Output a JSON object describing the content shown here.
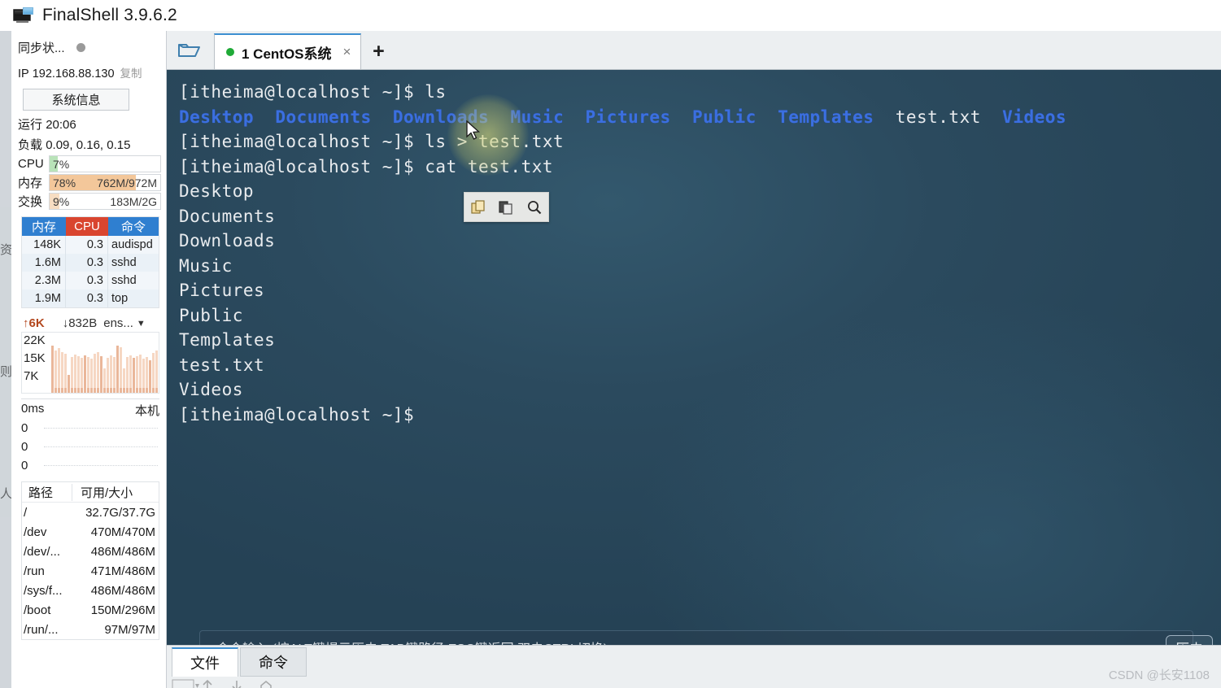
{
  "app": {
    "title": "FinalShell 3.9.6.2",
    "icon": "computer-monitor-icon"
  },
  "sidebar": {
    "ghost_text": "资 则 人",
    "sync": {
      "label": "同步状...",
      "dot": "status-dot"
    },
    "ip": {
      "prefix": "IP",
      "address": "192.168.88.130",
      "copy_label": "复制"
    },
    "sysinfo_button": "系统信息",
    "uptime": {
      "label": "运行",
      "value": "20:06"
    },
    "load": {
      "label": "负载",
      "value": "0.09, 0.16, 0.15"
    },
    "meters": [
      {
        "label": "CPU",
        "percent": "7%",
        "detail": "",
        "fill_pct": 7,
        "color": "#b9e3b9"
      },
      {
        "label": "内存",
        "percent": "78%",
        "detail": "762M/972M",
        "fill_pct": 78,
        "color": "#f3c79a"
      },
      {
        "label": "交换",
        "percent": "9%",
        "detail": "183M/2G",
        "fill_pct": 9,
        "color": "#f7ddc2"
      }
    ],
    "processes": {
      "headers": [
        "内存",
        "CPU",
        "命令"
      ],
      "header_colors": {
        "mem": "#2f7fd0",
        "cpu": "#d9452f",
        "cmd": "#2f7fd0"
      },
      "rows": [
        {
          "mem": "148K",
          "cpu": "0.3",
          "cmd": "audispd"
        },
        {
          "mem": "1.6M",
          "cpu": "0.3",
          "cmd": "sshd"
        },
        {
          "mem": "2.3M",
          "cpu": "0.3",
          "cmd": "sshd"
        },
        {
          "mem": "1.9M",
          "cpu": "0.3",
          "cmd": "top"
        }
      ]
    },
    "network": {
      "upload": "6K",
      "download": "832B",
      "interface": "ens...",
      "scale": [
        "22K",
        "15K",
        "7K"
      ]
    },
    "latency": {
      "unit": "0ms",
      "target": "本机",
      "rows": [
        "0",
        "0",
        "0"
      ]
    },
    "disk": {
      "headers": [
        "路径",
        "可用/大小"
      ],
      "rows": [
        {
          "path": "/",
          "size": "32.7G/37.7G"
        },
        {
          "path": "/dev",
          "size": "470M/470M"
        },
        {
          "path": "/dev/...",
          "size": "486M/486M"
        },
        {
          "path": "/run",
          "size": "471M/486M"
        },
        {
          "path": "/sys/f...",
          "size": "486M/486M"
        },
        {
          "path": "/boot",
          "size": "150M/296M"
        },
        {
          "path": "/run/...",
          "size": "97M/97M"
        }
      ]
    }
  },
  "tabbar": {
    "folder_icon": "open-folder-icon",
    "tabs": [
      {
        "label": "1 CentOS系统",
        "status_dot": "green",
        "close": "×"
      }
    ],
    "add_label": "+"
  },
  "terminal": {
    "prompt": "[itheima@localhost ~]$ ",
    "lines": [
      {
        "type": "prompt",
        "command": "ls"
      },
      {
        "type": "ls",
        "items": [
          {
            "name": "Desktop",
            "kind": "dir"
          },
          {
            "name": "Documents",
            "kind": "dir"
          },
          {
            "name": "Downloads",
            "kind": "dir"
          },
          {
            "name": "Music",
            "kind": "dir"
          },
          {
            "name": "Pictures",
            "kind": "dir"
          },
          {
            "name": "Public",
            "kind": "dir"
          },
          {
            "name": "Templates",
            "kind": "dir"
          },
          {
            "name": "test.txt",
            "kind": "file"
          },
          {
            "name": "Videos",
            "kind": "dir"
          }
        ]
      },
      {
        "type": "prompt",
        "command": "ls > test.txt"
      },
      {
        "type": "prompt",
        "command": "cat test.txt"
      },
      {
        "type": "out",
        "text": "Desktop"
      },
      {
        "type": "out",
        "text": "Documents"
      },
      {
        "type": "out",
        "text": "Downloads"
      },
      {
        "type": "out",
        "text": "Music"
      },
      {
        "type": "out",
        "text": "Pictures"
      },
      {
        "type": "out",
        "text": "Public"
      },
      {
        "type": "out",
        "text": "Templates"
      },
      {
        "type": "out",
        "text": "test.txt"
      },
      {
        "type": "out",
        "text": "Videos"
      },
      {
        "type": "prompt",
        "command": ""
      }
    ],
    "mini_toolbar": [
      "copy-icon",
      "paste-icon",
      "search-icon"
    ],
    "cursor": "mouse-pointer"
  },
  "command_bar": {
    "placeholder": "命令输入 (按ALT键提示历史,TAB键路径,ESC键返回,双击CTRL切换)",
    "history_button": "历史"
  },
  "bottom": {
    "tabs": [
      {
        "label": "文件",
        "active": true
      },
      {
        "label": "命令",
        "active": false
      }
    ],
    "toolbar_icons": [
      "dropdown-icon",
      "upload-icon",
      "download-icon",
      "refresh-icon",
      "home-icon"
    ]
  },
  "watermark": "CSDN @长安1108",
  "colors": {
    "terminal_bg": "#2b4a5e",
    "dir_blue": "#3b6fe0",
    "accent": "#3d8fd1",
    "green_dot": "#1faa37"
  }
}
